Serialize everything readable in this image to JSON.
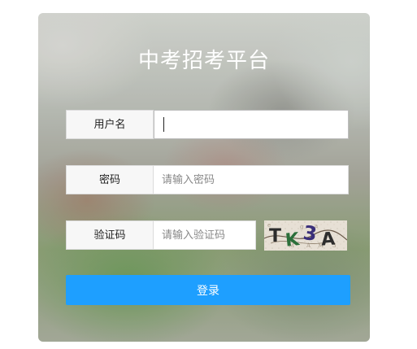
{
  "platform": {
    "title": "中考招考平台"
  },
  "form": {
    "username": {
      "label": "用户名",
      "value": "",
      "placeholder": ""
    },
    "password": {
      "label": "密码",
      "value": "",
      "placeholder": "请输入密码"
    },
    "captcha": {
      "label": "验证码",
      "value": "",
      "placeholder": "请输入验证码",
      "image_text": "TK3A"
    },
    "submit_label": "登录"
  },
  "colors": {
    "primary_button": "#1e9fff",
    "title_text": "#ffffff"
  }
}
